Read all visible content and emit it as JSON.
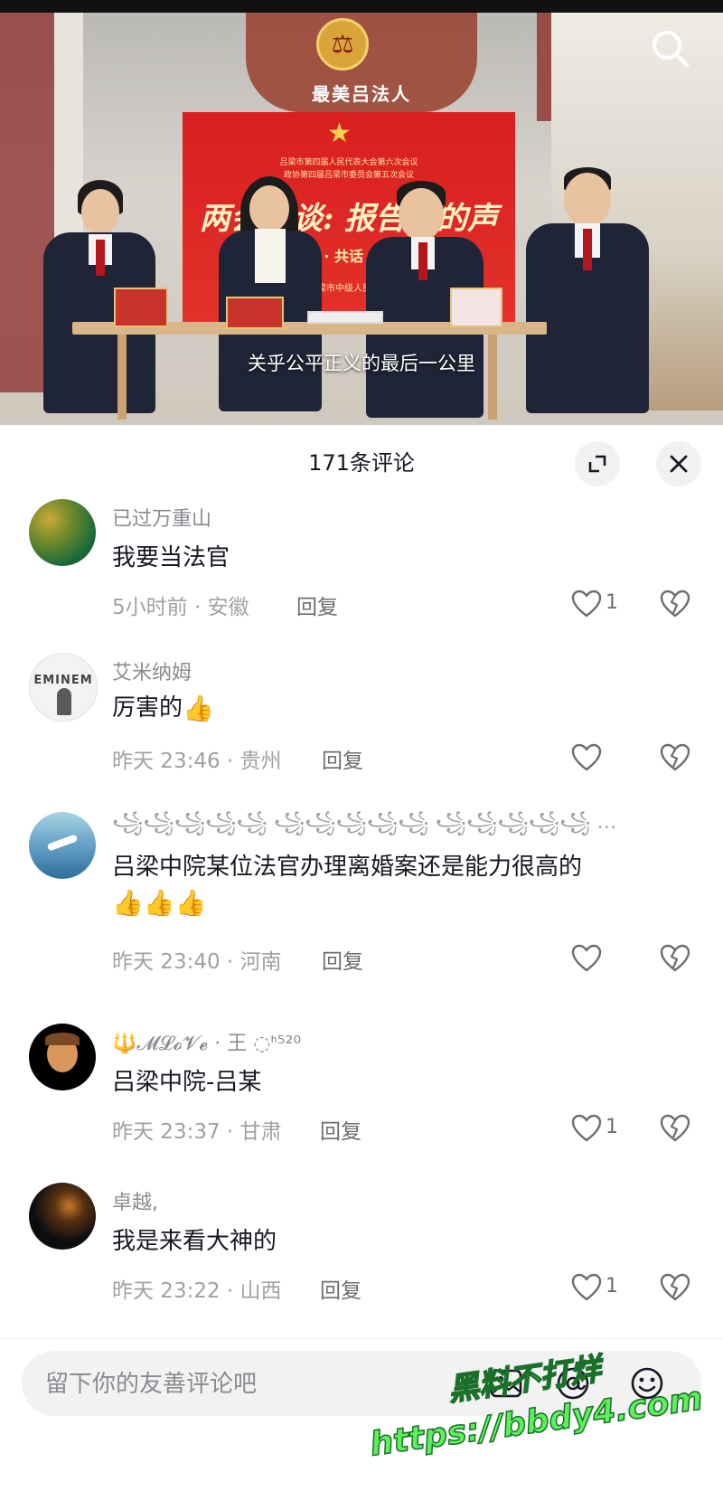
{
  "video": {
    "wall_title": "最美吕法人",
    "backdrop_line1": "吕梁市第四届人民代表大会第六次会议",
    "backdrop_line2": "政协第四届吕梁市委员会第五次会议",
    "backdrop_big": "两会访谈: 报告里的声",
    "backdrop_sub": "· 共话 ·",
    "backdrop_org": "吕梁市中级人民法院",
    "caption": "关乎公平正义的最后一公里",
    "search_icon": "search-icon"
  },
  "comments_panel": {
    "title": "171条评论",
    "expand_icon": "expand-icon",
    "close_icon": "close-icon"
  },
  "comments": [
    {
      "user": "已过万重山",
      "text": "我要当法官",
      "time_loc": "5小时前 · 安徽",
      "reply": "回复",
      "likes": "1",
      "avatar_colors": [
        "#1d6b3a",
        "#c9a83a"
      ]
    },
    {
      "user": "艾米纳姆",
      "text": "厉害的",
      "emoji": "👍",
      "time_loc": "昨天 23:46 · 贵州",
      "reply": "回复",
      "likes": "",
      "avatar_label": "EMINEM",
      "avatar_colors": [
        "#f5f5f5",
        "#3a3a3a"
      ]
    },
    {
      "user": "꧁꧁꧁꧁꧁ ꧁꧁꧁꧁꧁ ꧁꧁꧁꧁꧁ ꧁꧁꧁꧁꧁ ...",
      "text": "吕梁中院某位法官办理离婚案还是能力很高的",
      "emoji_line": "👍👍👍",
      "time_loc": "昨天 23:40 · 河南",
      "reply": "回复",
      "likes": "",
      "avatar_colors": [
        "#2e6e9e",
        "#a9d3e6"
      ]
    },
    {
      "user": "🔱𝓜𝓛𝓸𝓥𝓮 · 王 ◌ᑋ⁵²⁰",
      "text": "吕梁中院-吕某",
      "time_loc": "昨天 23:37 · 甘肃",
      "reply": "回复",
      "likes": "1",
      "avatar_colors": [
        "#000000",
        "#d9965b"
      ]
    },
    {
      "user": "卓越,",
      "text": "我是来看大神的",
      "time_loc": "昨天 23:22 · 山西",
      "reply": "回复",
      "likes": "1",
      "avatar_colors": [
        "#0d0d10",
        "#c77a2a"
      ]
    }
  ],
  "input": {
    "placeholder": "留下你的友善评论吧",
    "image_icon": "image-icon",
    "at_icon": "at-icon",
    "emoji_icon": "emoji-icon"
  },
  "watermark": {
    "line1": "黑料不打烊",
    "line2": "https://bbdy4.com"
  }
}
